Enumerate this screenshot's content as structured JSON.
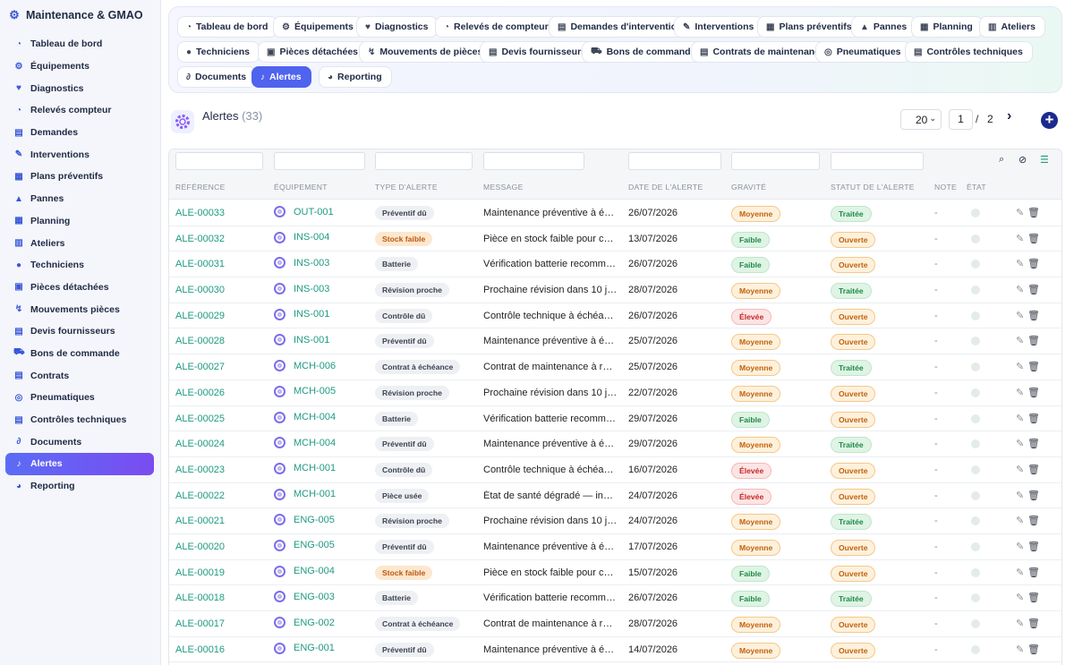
{
  "app": {
    "title": "Maintenance & GMAO"
  },
  "sidebar": {
    "items": [
      {
        "label": "Tableau de bord",
        "icon": "dashboard-icon",
        "glyph": "◔"
      },
      {
        "label": "Équipements",
        "icon": "cogs-icon",
        "glyph": "⚙"
      },
      {
        "label": "Diagnostics",
        "icon": "heartbeat-icon",
        "glyph": "♥"
      },
      {
        "label": "Relevés compteur",
        "icon": "gauge-icon",
        "glyph": "◔"
      },
      {
        "label": "Demandes",
        "icon": "clipboard-icon",
        "glyph": "▤"
      },
      {
        "label": "Interventions",
        "icon": "wrench-icon",
        "glyph": "✎"
      },
      {
        "label": "Plans préventifs",
        "icon": "calendar-icon",
        "glyph": "▦"
      },
      {
        "label": "Pannes",
        "icon": "warning-icon",
        "glyph": "▲"
      },
      {
        "label": "Planning",
        "icon": "calendar-icon",
        "glyph": "▦"
      },
      {
        "label": "Ateliers",
        "icon": "warehouse-icon",
        "glyph": "▥"
      },
      {
        "label": "Techniciens",
        "icon": "users-icon",
        "glyph": "●"
      },
      {
        "label": "Pièces détachées",
        "icon": "box-icon",
        "glyph": "▣"
      },
      {
        "label": "Mouvements pièces",
        "icon": "dolly-icon",
        "glyph": "↯"
      },
      {
        "label": "Devis fournisseurs",
        "icon": "file-invoice-icon",
        "glyph": "▤"
      },
      {
        "label": "Bons de commande",
        "icon": "cart-icon",
        "glyph": "⛟"
      },
      {
        "label": "Contrats",
        "icon": "file-contract-icon",
        "glyph": "▤"
      },
      {
        "label": "Pneumatiques",
        "icon": "tire-icon",
        "glyph": "◎"
      },
      {
        "label": "Contrôles techniques",
        "icon": "clipboard-check-icon",
        "glyph": "▤"
      },
      {
        "label": "Documents",
        "icon": "paperclip-icon",
        "glyph": "∂"
      },
      {
        "label": "Alertes",
        "icon": "bell-icon",
        "glyph": "♪",
        "active": true
      },
      {
        "label": "Reporting",
        "icon": "chart-pie-icon",
        "glyph": "◕"
      }
    ]
  },
  "tabs": [
    {
      "label": "Tableau de bord",
      "glyph": "◔"
    },
    {
      "label": "Équipements",
      "glyph": "⚙"
    },
    {
      "label": "Diagnostics",
      "glyph": "♥"
    },
    {
      "label": "Relevés de compteur",
      "glyph": "◔"
    },
    {
      "label": "Demandes d'intervention",
      "glyph": "▤"
    },
    {
      "label": "Interventions",
      "glyph": "✎"
    },
    {
      "label": "Plans préventifs",
      "glyph": "▦"
    },
    {
      "label": "Pannes",
      "glyph": "▲"
    },
    {
      "label": "Planning",
      "glyph": "▦"
    },
    {
      "label": "Ateliers",
      "glyph": "▥"
    },
    {
      "label": "Techniciens",
      "glyph": "●"
    },
    {
      "label": "Pièces détachées",
      "glyph": "▣"
    },
    {
      "label": "Mouvements de pièces",
      "glyph": "↯"
    },
    {
      "label": "Devis fournisseurs",
      "glyph": "▤"
    },
    {
      "label": "Bons de commande",
      "glyph": "⛟"
    },
    {
      "label": "Contrats de maintenance",
      "glyph": "▤"
    },
    {
      "label": "Pneumatiques",
      "glyph": "◎"
    },
    {
      "label": "Contrôles techniques",
      "glyph": "▤"
    },
    {
      "label": "Documents",
      "glyph": "∂"
    },
    {
      "label": "Alertes",
      "glyph": "♪",
      "active": true
    },
    {
      "label": "Reporting",
      "glyph": "◕"
    }
  ],
  "header": {
    "title": "Alertes",
    "count": "(33)",
    "per_page": "20",
    "page": "1",
    "page_sep": "/",
    "page_total": "2"
  },
  "table": {
    "columns": [
      "Référence",
      "Équipement",
      "Type d'alerte",
      "Message",
      "Date de l'alerte",
      "Gravité",
      "Statut de l'alerte",
      "Note",
      "État"
    ],
    "rows": [
      {
        "ref": "ALE-00033",
        "eq": "OUT-001",
        "type": "Préventif dû",
        "type_style": "gray",
        "msg": "Maintenance préventive à éc…",
        "date": "26/07/2026",
        "sev": "Moyenne",
        "status": "Traitée",
        "note": "-"
      },
      {
        "ref": "ALE-00032",
        "eq": "INS-004",
        "type": "Stock faible",
        "type_style": "orange",
        "msg": "Pièce en stock faible pour cet…",
        "date": "13/07/2026",
        "sev": "Faible",
        "status": "Ouverte",
        "note": "-"
      },
      {
        "ref": "ALE-00031",
        "eq": "INS-003",
        "type": "Batterie",
        "type_style": "gray",
        "msg": "Vérification batterie recomma…",
        "date": "26/07/2026",
        "sev": "Faible",
        "status": "Ouverte",
        "note": "-"
      },
      {
        "ref": "ALE-00030",
        "eq": "INS-003",
        "type": "Révision proche",
        "type_style": "gray",
        "msg": "Prochaine révision dans 10 jo…",
        "date": "28/07/2026",
        "sev": "Moyenne",
        "status": "Traitée",
        "note": "-"
      },
      {
        "ref": "ALE-00029",
        "eq": "INS-001",
        "type": "Contrôle dû",
        "type_style": "gray",
        "msg": "Contrôle technique à échéance",
        "date": "26/07/2026",
        "sev": "Élevée",
        "status": "Ouverte",
        "note": "-"
      },
      {
        "ref": "ALE-00028",
        "eq": "INS-001",
        "type": "Préventif dû",
        "type_style": "gray",
        "msg": "Maintenance préventive à éc…",
        "date": "25/07/2026",
        "sev": "Moyenne",
        "status": "Ouverte",
        "note": "-"
      },
      {
        "ref": "ALE-00027",
        "eq": "MCH-006",
        "type": "Contrat à échéance",
        "type_style": "gray",
        "msg": "Contrat de maintenance à ren…",
        "date": "25/07/2026",
        "sev": "Moyenne",
        "status": "Traitée",
        "note": "-"
      },
      {
        "ref": "ALE-00026",
        "eq": "MCH-005",
        "type": "Révision proche",
        "type_style": "gray",
        "msg": "Prochaine révision dans 10 jo…",
        "date": "22/07/2026",
        "sev": "Moyenne",
        "status": "Ouverte",
        "note": "-"
      },
      {
        "ref": "ALE-00025",
        "eq": "MCH-004",
        "type": "Batterie",
        "type_style": "gray",
        "msg": "Vérification batterie recomma…",
        "date": "29/07/2026",
        "sev": "Faible",
        "status": "Ouverte",
        "note": "-"
      },
      {
        "ref": "ALE-00024",
        "eq": "MCH-004",
        "type": "Préventif dû",
        "type_style": "gray",
        "msg": "Maintenance préventive à éc…",
        "date": "29/07/2026",
        "sev": "Moyenne",
        "status": "Traitée",
        "note": "-"
      },
      {
        "ref": "ALE-00023",
        "eq": "MCH-001",
        "type": "Contrôle dû",
        "type_style": "gray",
        "msg": "Contrôle technique à échéance",
        "date": "16/07/2026",
        "sev": "Élevée",
        "status": "Ouverte",
        "note": "-"
      },
      {
        "ref": "ALE-00022",
        "eq": "MCH-001",
        "type": "Pièce usée",
        "type_style": "gray",
        "msg": "État de santé dégradé — insp…",
        "date": "24/07/2026",
        "sev": "Élevée",
        "status": "Ouverte",
        "note": "-"
      },
      {
        "ref": "ALE-00021",
        "eq": "ENG-005",
        "type": "Révision proche",
        "type_style": "gray",
        "msg": "Prochaine révision dans 10 jo…",
        "date": "24/07/2026",
        "sev": "Moyenne",
        "status": "Traitée",
        "note": "-"
      },
      {
        "ref": "ALE-00020",
        "eq": "ENG-005",
        "type": "Préventif dû",
        "type_style": "gray",
        "msg": "Maintenance préventive à éc…",
        "date": "17/07/2026",
        "sev": "Moyenne",
        "status": "Ouverte",
        "note": "-"
      },
      {
        "ref": "ALE-00019",
        "eq": "ENG-004",
        "type": "Stock faible",
        "type_style": "orange",
        "msg": "Pièce en stock faible pour cet…",
        "date": "15/07/2026",
        "sev": "Faible",
        "status": "Ouverte",
        "note": "-"
      },
      {
        "ref": "ALE-00018",
        "eq": "ENG-003",
        "type": "Batterie",
        "type_style": "gray",
        "msg": "Vérification batterie recomma…",
        "date": "26/07/2026",
        "sev": "Faible",
        "status": "Traitée",
        "note": "-"
      },
      {
        "ref": "ALE-00017",
        "eq": "ENG-002",
        "type": "Contrat à échéance",
        "type_style": "gray",
        "msg": "Contrat de maintenance à ren…",
        "date": "28/07/2026",
        "sev": "Moyenne",
        "status": "Ouverte",
        "note": "-"
      },
      {
        "ref": "ALE-00016",
        "eq": "ENG-001",
        "type": "Préventif dû",
        "type_style": "gray",
        "msg": "Maintenance préventive à éc…",
        "date": "14/07/2026",
        "sev": "Moyenne",
        "status": "Ouverte",
        "note": "-"
      }
    ]
  },
  "colors": {
    "accent": "#4f63ee",
    "link": "#1f9b80",
    "sev_moyenne": "#c2610c",
    "sev_faible": "#1f8a48",
    "sev_elevee": "#c62828"
  }
}
